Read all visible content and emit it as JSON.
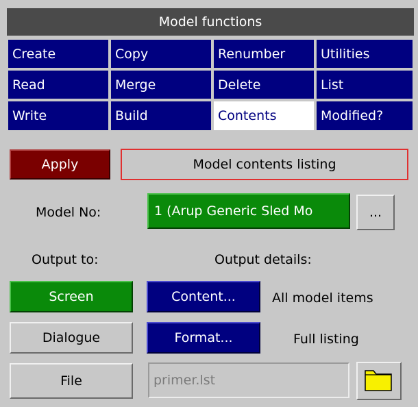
{
  "window": {
    "title": "Model functions"
  },
  "menu": {
    "items": [
      {
        "label": "Create",
        "name": "menu-create",
        "selected": false
      },
      {
        "label": "Copy",
        "name": "menu-copy",
        "selected": false
      },
      {
        "label": "Renumber",
        "name": "menu-renumber",
        "selected": false
      },
      {
        "label": "Utilities",
        "name": "menu-utilities",
        "selected": false
      },
      {
        "label": "Read",
        "name": "menu-read",
        "selected": false
      },
      {
        "label": "Merge",
        "name": "menu-merge",
        "selected": false
      },
      {
        "label": "Delete",
        "name": "menu-delete",
        "selected": false
      },
      {
        "label": "List",
        "name": "menu-list",
        "selected": false
      },
      {
        "label": "Write",
        "name": "menu-write",
        "selected": false
      },
      {
        "label": "Build",
        "name": "menu-build",
        "selected": false
      },
      {
        "label": "Contents",
        "name": "menu-contents",
        "selected": true
      },
      {
        "label": "Modified?",
        "name": "menu-modified",
        "selected": false
      }
    ]
  },
  "action": {
    "apply_label": "Apply",
    "mode_label": "Model contents listing"
  },
  "model": {
    "label": "Model No:",
    "value": "1 (Arup Generic Sled Mo",
    "browse_label": "..."
  },
  "output": {
    "output_to_label": "Output to:",
    "details_label": "Output details:",
    "screen_label": "Screen",
    "dialogue_label": "Dialogue",
    "file_label": "File",
    "content_button": "Content...",
    "content_value": "All model items",
    "format_button": "Format...",
    "format_value": "Full listing",
    "filename": "primer.lst",
    "selected_target": "Screen"
  },
  "colors": {
    "menu_bg": "#000080",
    "apply_bg": "#7a0000",
    "active_green": "#0a8a0a",
    "highlight_border": "#e03030"
  },
  "icons": {
    "folder": "folder-icon"
  }
}
